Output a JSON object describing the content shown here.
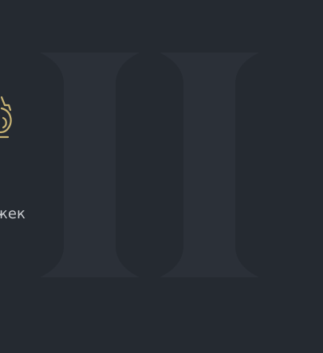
{
  "stat": {
    "icon": "ring-icon",
    "label": "жек"
  },
  "colors": {
    "background": "#252a31",
    "watermark": "#2b3038",
    "accent": "#c8b374",
    "text": "#c9ccd0"
  }
}
